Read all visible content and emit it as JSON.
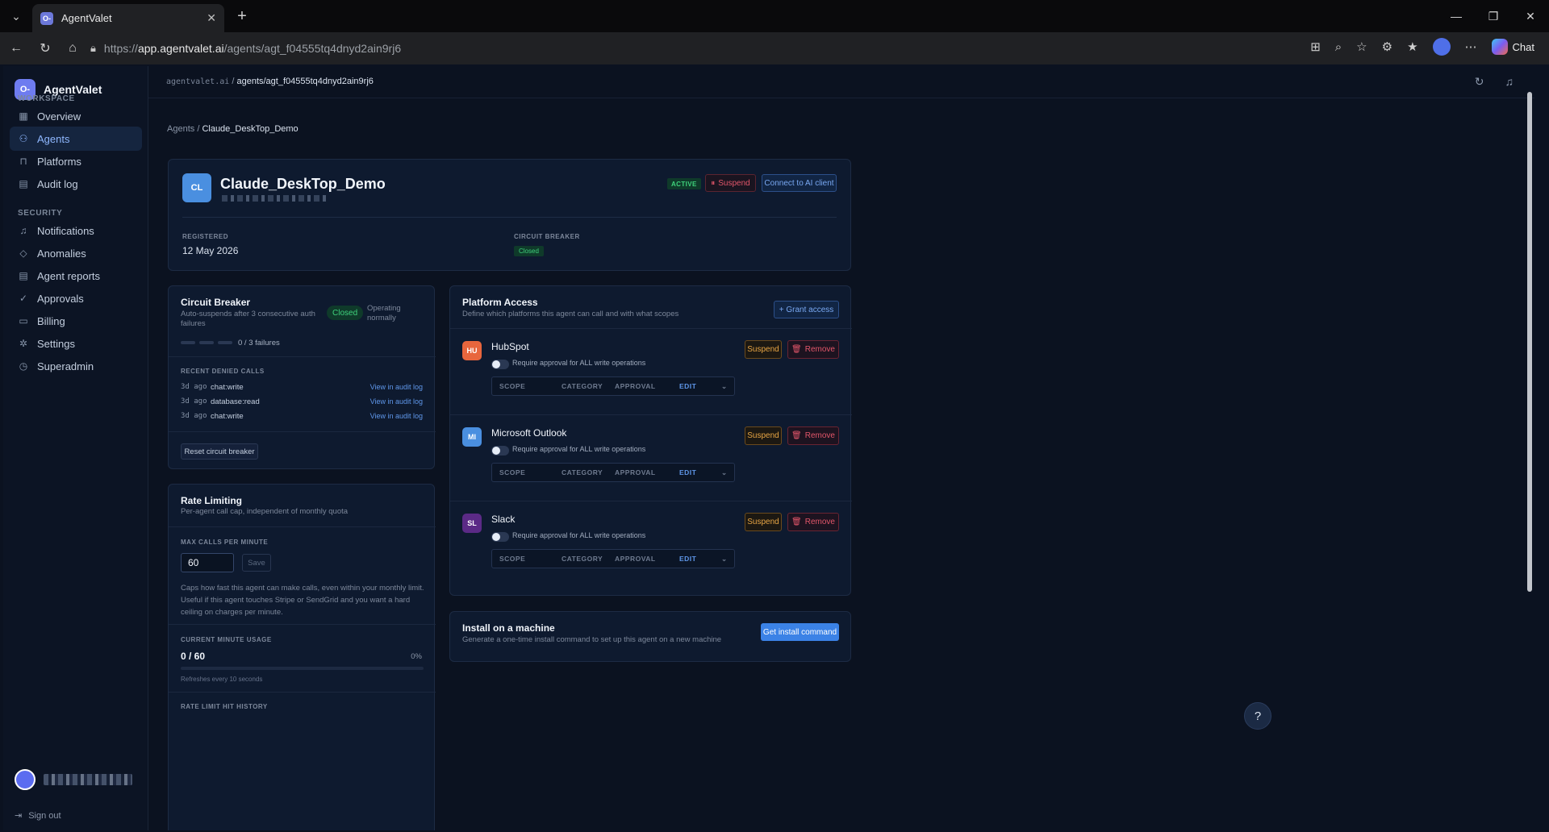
{
  "browser": {
    "tab_title": "AgentValet",
    "url_prefix": "https://",
    "url_host": "app.agentvalet.ai",
    "url_path": "/agents/agt_f04555tq4dnyd2ain9rj6",
    "chat_label": "Chat",
    "new_tab_glyph": "+",
    "win_min": "—",
    "win_restore": "❐",
    "win_close": "✕"
  },
  "sidebar": {
    "brand": "AgentValet",
    "brand_logo": "O-",
    "workspace_label": "WORKSPACE",
    "workspace_items": [
      {
        "label": "Overview",
        "icon": "grid-icon"
      },
      {
        "label": "Agents",
        "icon": "user-icon"
      },
      {
        "label": "Platforms",
        "icon": "briefcase-icon"
      },
      {
        "label": "Audit log",
        "icon": "document-icon"
      }
    ],
    "security_label": "SECURITY",
    "security_items": [
      {
        "label": "Notifications",
        "icon": "bell-icon"
      },
      {
        "label": "Anomalies",
        "icon": "shield-icon"
      },
      {
        "label": "Agent reports",
        "icon": "report-icon"
      },
      {
        "label": "Approvals",
        "icon": "check-circle-icon"
      },
      {
        "label": "Billing",
        "icon": "card-icon"
      },
      {
        "label": "Settings",
        "icon": "gear-icon"
      },
      {
        "label": "Superadmin",
        "icon": "clock-icon"
      }
    ],
    "sign_out": "Sign out"
  },
  "topbar": {
    "crumb_root": "agentvalet.ai",
    "crumb_sep": "/",
    "crumb_current": "agents/agt_f04555tq4dnyd2ain9rj6"
  },
  "page": {
    "crumb_parent": "Agents",
    "crumb_sep": "/",
    "crumb_current": "Claude_DeskTop_Demo"
  },
  "agent": {
    "initials": "CL",
    "name": "Claude_DeskTop_Demo",
    "status": "ACTIVE",
    "suspend_label": "Suspend",
    "connect_label": "Connect to AI client",
    "registered_label": "REGISTERED",
    "registered_value": "12 May 2026",
    "circuit_label": "CIRCUIT BREAKER",
    "circuit_value": "Closed"
  },
  "circuit_breaker": {
    "title": "Circuit Breaker",
    "subtitle": "Auto-suspends after 3 consecutive auth failures",
    "status": "Closed",
    "status_note": "Operating normally",
    "failures": "0 / 3 failures",
    "failures_count": 0,
    "failures_max": 3,
    "denied_label": "RECENT DENIED CALLS",
    "denied": [
      {
        "time": "3d ago",
        "scope": "chat:write",
        "link": "View in audit log"
      },
      {
        "time": "3d ago",
        "scope": "database:read",
        "link": "View in audit log"
      },
      {
        "time": "3d ago",
        "scope": "chat:write",
        "link": "View in audit log"
      }
    ],
    "reset_label": "Reset circuit breaker"
  },
  "rate_limit": {
    "title": "Rate Limiting",
    "subtitle": "Per-agent call cap, independent of monthly quota",
    "max_label": "MAX CALLS PER MINUTE",
    "max_value": "60",
    "save_label": "Save",
    "help": "Caps how fast this agent can make calls, even within your monthly limit. Useful if this agent touches Stripe or SendGrid and you want a hard ceiling on charges per minute.",
    "usage_label": "CURRENT MINUTE USAGE",
    "usage_value": "0 / 60",
    "usage_pct": "0%",
    "usage_fraction": 0,
    "refresh_note": "Refreshes every 10 seconds",
    "history_label": "RATE LIMIT HIT HISTORY"
  },
  "platform_access": {
    "title": "Platform Access",
    "subtitle": "Define which platforms this agent can call and with what scopes",
    "grant_label": "+ Grant access",
    "toggle_label": "Require approval for ALL write operations",
    "col_scope": "SCOPE",
    "col_category": "CATEGORY",
    "col_approval": "APPROVAL",
    "col_edit": "EDIT",
    "suspend_label": "Suspend",
    "remove_label": "Remove",
    "platforms": [
      {
        "initials": "HU",
        "name": "HubSpot",
        "color": "#e8663d"
      },
      {
        "initials": "MI",
        "name": "Microsoft Outlook",
        "color": "#4a8fe0"
      },
      {
        "initials": "SL",
        "name": "Slack",
        "color": "#5b2a86"
      }
    ]
  },
  "install": {
    "title": "Install on a machine",
    "subtitle": "Generate a one-time install command to set up this agent on a new machine",
    "button": "Get install command"
  },
  "help_fab": "?"
}
